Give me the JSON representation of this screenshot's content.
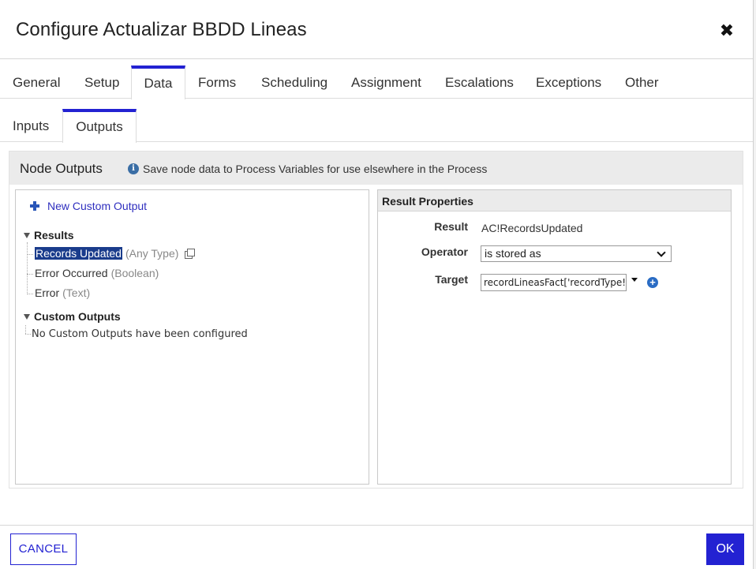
{
  "dialog": {
    "title": "Configure Actualizar BBDD Lineas"
  },
  "tabs": [
    "General",
    "Setup",
    "Data",
    "Forms",
    "Scheduling",
    "Assignment",
    "Escalations",
    "Exceptions",
    "Other"
  ],
  "active_tab": "Data",
  "subtabs": [
    "Inputs",
    "Outputs"
  ],
  "active_subtab": "Outputs",
  "node_outputs": {
    "title": "Node Outputs",
    "info_text": "Save node data to Process Variables for use elsewhere in the Process"
  },
  "tree": {
    "new_custom_output": "New Custom Output",
    "results_label": "Results",
    "results": [
      {
        "name": "Records Updated",
        "type": "(Any Type)",
        "selected": true
      },
      {
        "name": "Error Occurred",
        "type": "(Boolean)"
      },
      {
        "name": "Error",
        "type": "(Text)"
      }
    ],
    "custom_outputs_label": "Custom Outputs",
    "custom_outputs_empty": "No Custom Outputs have been configured"
  },
  "result_properties": {
    "title": "Result Properties",
    "result_label": "Result",
    "result_value": "AC!RecordsUpdated",
    "operator_label": "Operator",
    "operator_value": "is stored as",
    "target_label": "Target",
    "target_value": "recordLineasFact['recordType!{"
  },
  "footer": {
    "cancel": "CANCEL",
    "ok": "OK"
  },
  "colors": {
    "accent": "#2322d2",
    "selection": "#1a3c8c",
    "panel_header": "#ebebeb"
  }
}
